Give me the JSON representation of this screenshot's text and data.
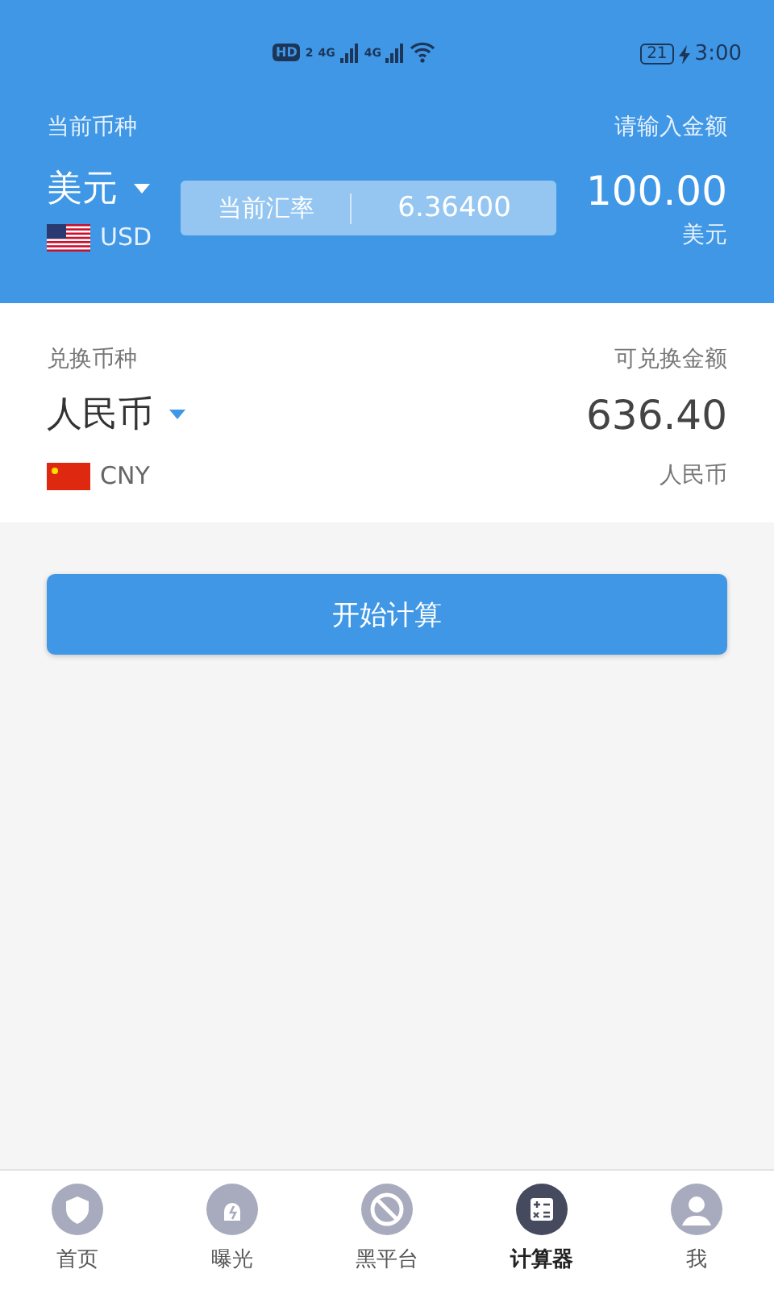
{
  "status_bar": {
    "hd": "HD",
    "sim": "2",
    "networks": [
      "4G",
      "4G"
    ],
    "battery": "21",
    "time": "3:00"
  },
  "source": {
    "label": "当前币种",
    "currency": "美元",
    "code": "USD",
    "kind": "us",
    "rate_label": "当前汇率",
    "rate": "6.36400",
    "amount_label": "请输入金额",
    "amount": "100.00",
    "amount_unit": "美元"
  },
  "target": {
    "label": "兑换币种",
    "currency": "人民币",
    "code": "CNY",
    "kind": "cn",
    "amount_label": "可兑换金额",
    "amount": "636.40",
    "amount_unit": "人民币"
  },
  "calculate_button": "开始计算",
  "tabs": [
    {
      "label": "首页",
      "kind": "shield",
      "selected": false
    },
    {
      "label": "曝光",
      "kind": "alarm",
      "selected": false
    },
    {
      "label": "黑平台",
      "kind": "ban",
      "selected": false
    },
    {
      "label": "计算器",
      "kind": "calculator",
      "selected": true
    },
    {
      "label": "我",
      "kind": "user",
      "selected": false
    }
  ]
}
